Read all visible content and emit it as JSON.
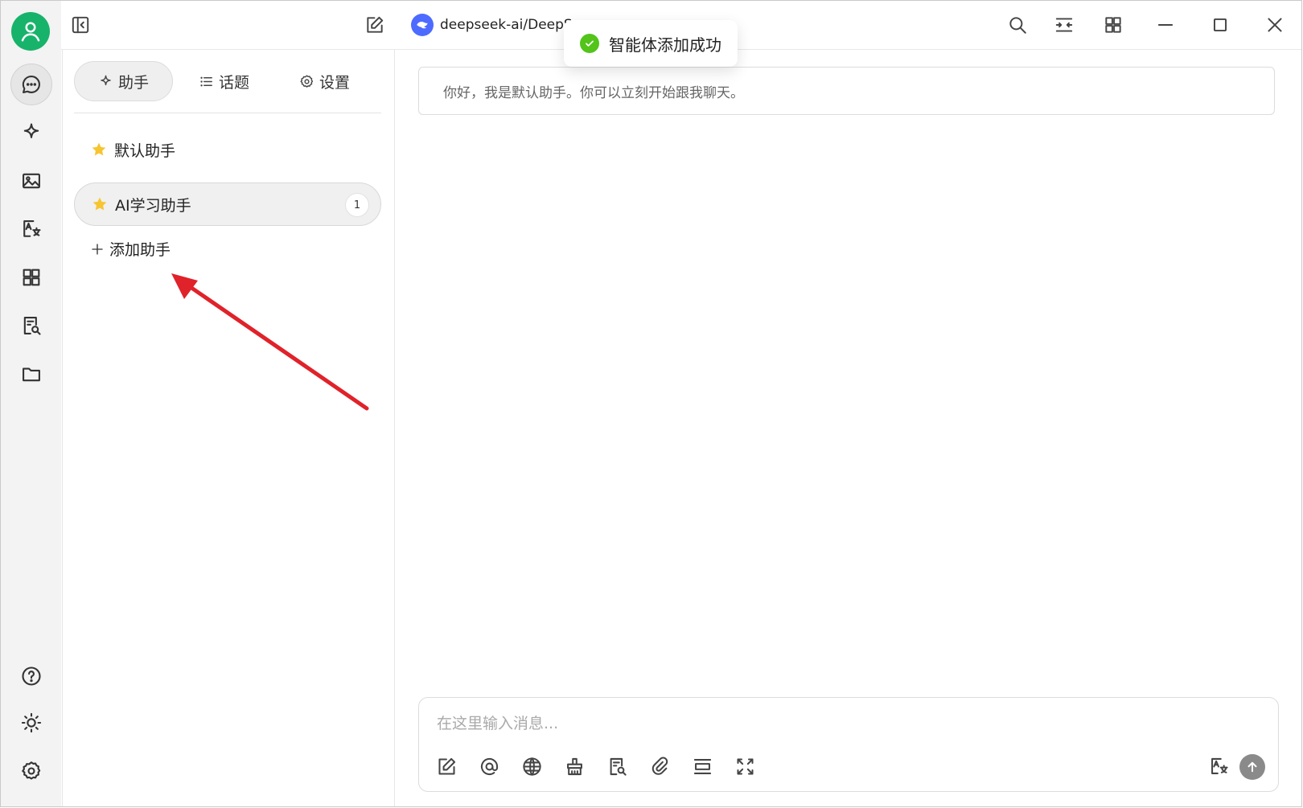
{
  "topbar": {
    "model_name": "deepseek-ai/DeepSe"
  },
  "toast": {
    "message": "智能体添加成功",
    "status_color": "#52c41a"
  },
  "assistant_panel": {
    "tabs": [
      {
        "label": "助手",
        "icon": "sparkle-icon",
        "active": true
      },
      {
        "label": "话题",
        "icon": "list-icon",
        "active": false
      },
      {
        "label": "设置",
        "icon": "gear-icon",
        "active": false
      }
    ],
    "items": [
      {
        "label": "默认助手",
        "icon": "star-icon",
        "active": false
      },
      {
        "label": "AI学习助手",
        "icon": "star-icon",
        "active": true,
        "badge": "1"
      }
    ],
    "add_label": "添加助手"
  },
  "chat": {
    "greeting": "你好，我是默认助手。你可以立刻开始跟我聊天。",
    "input_placeholder": "在这里输入消息..."
  },
  "colors": {
    "avatar": "#17b36b",
    "model_logo": "#4d6bfe",
    "annotation_arrow": "#e0222a",
    "star": "#f7c531"
  }
}
